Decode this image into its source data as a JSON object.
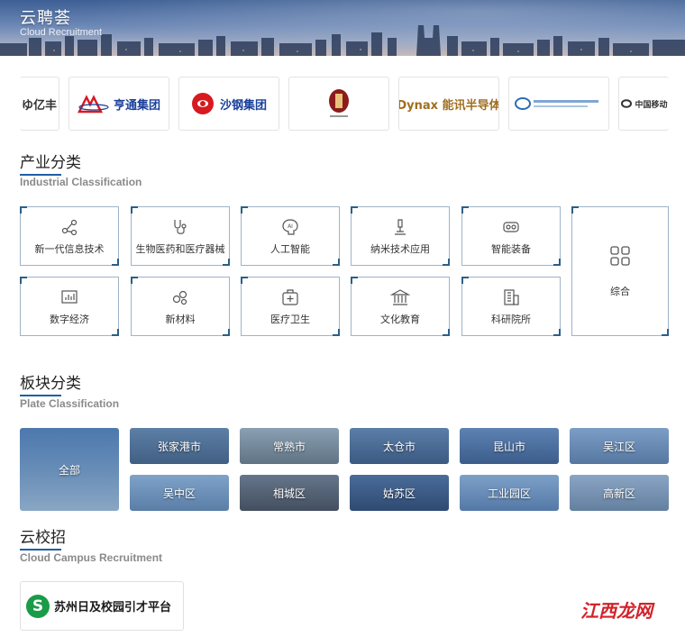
{
  "banner": {
    "title": "云聘荟",
    "subtitle": "Cloud Recruitment"
  },
  "logos": [
    {
      "name": "亿丰",
      "text": "ゆ亿丰",
      "color": "#333333"
    },
    {
      "name": "亨通集团",
      "text": "亨通集团",
      "color": "#1a3f9a"
    },
    {
      "name": "沙钢集团",
      "text": "沙钢集团",
      "color": "#1a3f9a"
    },
    {
      "name": "seal-logo",
      "text": "",
      "color": "#8a1c1c"
    },
    {
      "name": "Dynax",
      "text": "Dynax 能讯半导体",
      "color": "#a06e1e"
    },
    {
      "name": "blue-company",
      "text": "",
      "color": "#2a6cb5"
    },
    {
      "name": "中国移动",
      "text": "中国移动",
      "color": "#333333"
    }
  ],
  "industry": {
    "title": "产业分类",
    "subtitle": "Industrial Classification",
    "items": [
      {
        "label": "新一代信息技术",
        "icon": "network-icon"
      },
      {
        "label": "生物医药和医疗器械",
        "icon": "stethoscope-icon"
      },
      {
        "label": "人工智能",
        "icon": "ai-icon"
      },
      {
        "label": "纳米技术应用",
        "icon": "microscope-icon"
      },
      {
        "label": "智能装备",
        "icon": "vr-headset-icon"
      },
      {
        "label": "综合",
        "icon": "grid-icon"
      },
      {
        "label": "数字经济",
        "icon": "chart-icon"
      },
      {
        "label": "新材料",
        "icon": "molecule-icon"
      },
      {
        "label": "医疗卫生",
        "icon": "medical-kit-icon"
      },
      {
        "label": "文化教育",
        "icon": "building-icon"
      },
      {
        "label": "科研院所",
        "icon": "office-icon"
      }
    ]
  },
  "plate": {
    "title": "板块分类",
    "subtitle": "Plate Classification",
    "all": "全部",
    "items": [
      {
        "label": "张家港市",
        "bg": "#5d7fa6"
      },
      {
        "label": "常熟市",
        "bg": "#7c8fa0"
      },
      {
        "label": "太仓市",
        "bg": "#4d6f98"
      },
      {
        "label": "昆山市",
        "bg": "#4f73a5"
      },
      {
        "label": "吴江区",
        "bg": "#6b8fb9"
      },
      {
        "label": "吴中区",
        "bg": "#6e93bb"
      },
      {
        "label": "相城区",
        "bg": "#556579"
      },
      {
        "label": "姑苏区",
        "bg": "#3f5f8d"
      },
      {
        "label": "工业园区",
        "bg": "#6c8fbb"
      },
      {
        "label": "高新区",
        "bg": "#7b96b8"
      }
    ]
  },
  "campus": {
    "title": "云校招",
    "subtitle": "Cloud Campus Recruitment",
    "card_label": "苏州日及校园引才平台",
    "logo_letter": "S"
  },
  "watermark": "江西龙网"
}
